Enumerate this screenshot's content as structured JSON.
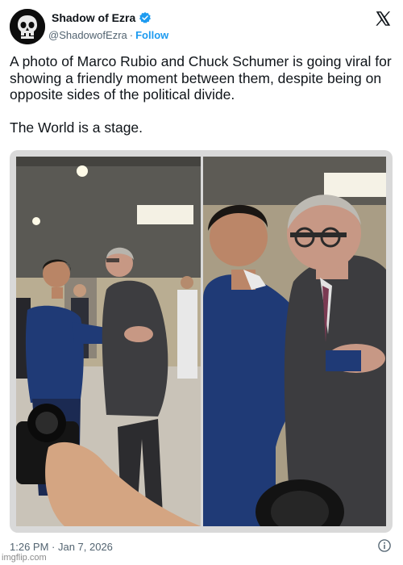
{
  "post": {
    "display_name": "Shadow of Ezra",
    "handle": "@ShadowofEzra",
    "separator": "·",
    "follow_label": "Follow",
    "text": "A photo of Marco Rubio and Chuck Schumer is going viral for showing a friendly moment between them, despite being on opposite sides of the political divide.\n\nThe World is a stage.",
    "timestamp": "1:26 PM · Jan 7, 2026"
  },
  "media": {
    "photo_count": 2
  },
  "icons": {
    "avatar": "skull-avatar",
    "verified": "verified-badge-icon",
    "platform": "x-logo-icon",
    "info": "info-icon"
  },
  "colors": {
    "accent": "#1d9bf0",
    "secondary_text": "#536471",
    "primary_text": "#0f1419"
  },
  "watermark": "imgflip.com"
}
